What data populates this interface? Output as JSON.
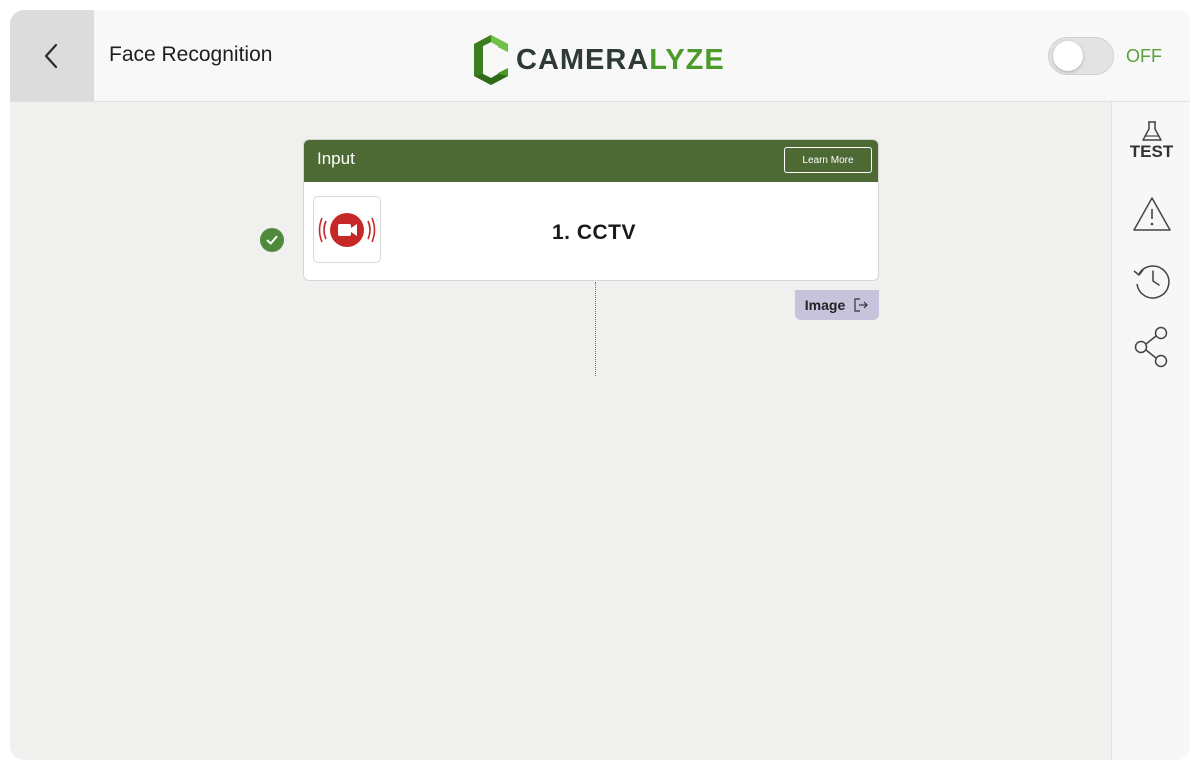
{
  "header": {
    "title": "Face Recognition",
    "logo_part1": "CAMERA",
    "logo_part2": "LYZE",
    "toggle_state": "OFF",
    "back_icon": "chevron-left-icon"
  },
  "sidebar": {
    "test_label": "TEST",
    "icons": [
      "flask-icon",
      "warning-icon",
      "history-icon",
      "share-icon"
    ]
  },
  "node": {
    "header": "Input",
    "learn_more": "Learn More",
    "label": "1. CCTV",
    "icon": "cctv-camera-icon",
    "status_icon": "check-icon",
    "output": "Image",
    "output_icon": "export-icon"
  },
  "colors": {
    "brand_green": "#4c9a2a",
    "node_header": "#4d6a35",
    "output_tab": "#c7c3dc",
    "status_ok": "#4f8a3c"
  }
}
